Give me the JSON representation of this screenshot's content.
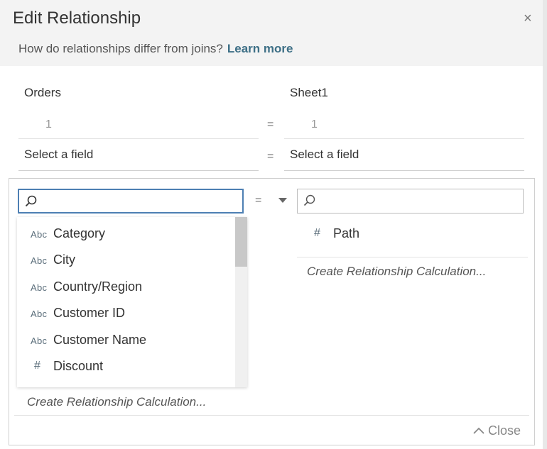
{
  "dialog": {
    "title": "Edit Relationship",
    "subtitle": "How do relationships differ from joins?",
    "learn_more": "Learn more",
    "close_icon": "×"
  },
  "left": {
    "table_name": "Orders",
    "row_count": "1",
    "field_placeholder": "Select a field"
  },
  "right": {
    "table_name": "Sheet1",
    "row_count": "1",
    "field_placeholder": "Select a field"
  },
  "operator": "=",
  "picker": {
    "left_fields": [
      {
        "type": "Abc",
        "label": "Category"
      },
      {
        "type": "Abc",
        "label": "City"
      },
      {
        "type": "Abc",
        "label": "Country/Region"
      },
      {
        "type": "Abc",
        "label": "Customer ID"
      },
      {
        "type": "Abc",
        "label": "Customer Name"
      },
      {
        "type": "#",
        "label": "Discount"
      }
    ],
    "right_fields": [
      {
        "type": "#",
        "label": "Path"
      }
    ],
    "create_calc": "Create Relationship Calculation...",
    "close_label": "Close",
    "close_icon": "^"
  },
  "colors": {
    "header_bg": "#f3f3f3",
    "learn_more": "#3d6f86",
    "active_border": "#4d7fb3"
  },
  "icons": [
    "close-icon",
    "search-icon",
    "chevron-down-icon",
    "chevron-up-icon",
    "string-type-icon",
    "number-type-icon"
  ]
}
